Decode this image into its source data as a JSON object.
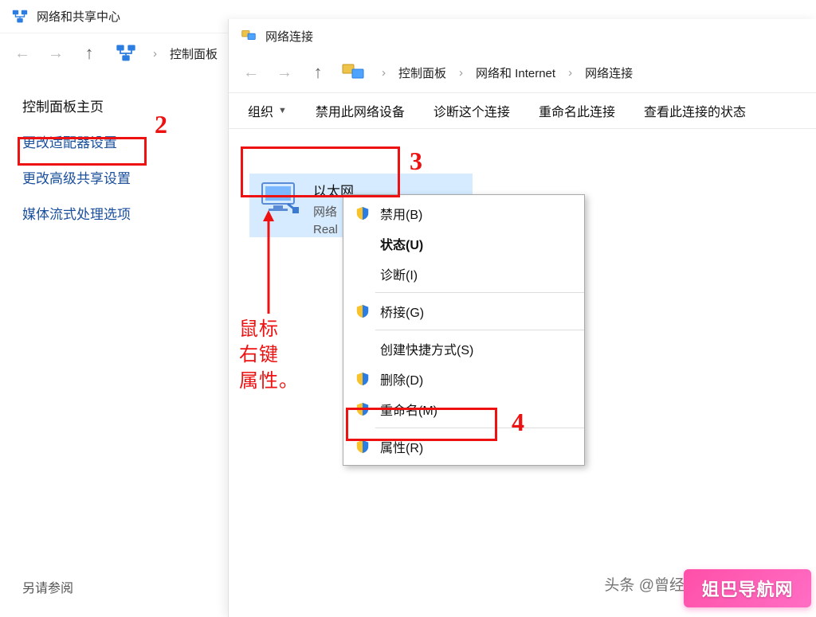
{
  "back_window": {
    "title": "网络和共享中心",
    "breadcrumb": "控制面板"
  },
  "side_links": {
    "home": "控制面板主页",
    "adapter": "更改适配器设置",
    "advanced": "更改高级共享设置",
    "streaming": "媒体流式处理选项"
  },
  "see_also": "另请参阅",
  "front_window": {
    "title": "网络连接",
    "crumbs": {
      "c1": "控制面板",
      "c2": "网络和 Internet",
      "c3": "网络连接"
    },
    "toolbar": {
      "organize": "组织",
      "disable": "禁用此网络设备",
      "diagnose": "诊断这个连接",
      "rename": "重命名此连接",
      "status": "查看此连接的状态"
    },
    "adapter": {
      "name": "以太网",
      "sub": "网络",
      "nic": "Real"
    }
  },
  "context_menu": {
    "disable": "禁用(B)",
    "status": "状态(U)",
    "diagnose": "诊断(I)",
    "bridge": "桥接(G)",
    "shortcut": "创建快捷方式(S)",
    "delete": "删除(D)",
    "rename": "重命名(M)",
    "properties": "属性(R)"
  },
  "annotations": {
    "n2": "2",
    "n3": "3",
    "n4": "4",
    "note": "鼠标\n右键\n属性。"
  },
  "watermark": {
    "source": "头条 @曾经的电脑小哥",
    "brand": "姐巴导航网"
  }
}
